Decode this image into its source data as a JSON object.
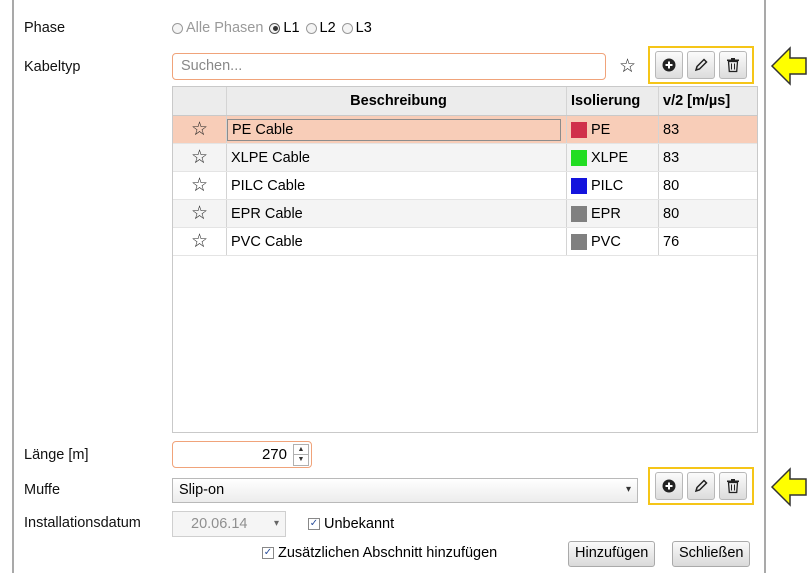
{
  "labels": {
    "phase": "Phase",
    "kabeltyp": "Kabeltyp",
    "laenge": "Länge [m]",
    "muffe": "Muffe",
    "installationsdatum": "Installationsdatum"
  },
  "phase_options": [
    {
      "label": "Alle Phasen",
      "state": "disabled"
    },
    {
      "label": "L1",
      "state": "checked"
    },
    {
      "label": "L2",
      "state": "unchecked"
    },
    {
      "label": "L3",
      "state": "unchecked"
    }
  ],
  "search": {
    "placeholder": "Suchen..."
  },
  "table": {
    "headers": {
      "description": "Beschreibung",
      "insulation": "Isolierung",
      "velocity": "v/2 [m/µs]"
    },
    "rows": [
      {
        "description": "PE Cable",
        "insulation": "PE",
        "color": "#d0304a",
        "velocity": "83"
      },
      {
        "description": "XLPE Cable",
        "insulation": "XLPE",
        "color": "#22dd22",
        "velocity": "83"
      },
      {
        "description": "PILC Cable",
        "insulation": "PILC",
        "color": "#1414dd",
        "velocity": "80"
      },
      {
        "description": "EPR Cable",
        "insulation": "EPR",
        "color": "#808080",
        "velocity": "80"
      },
      {
        "description": "PVC Cable",
        "insulation": "PVC",
        "color": "#808080",
        "velocity": "76"
      }
    ]
  },
  "length": {
    "value": "270"
  },
  "muffe": {
    "value": "Slip-on"
  },
  "date": {
    "value": "20.06.14"
  },
  "unbekannt": {
    "label": "Unbekannt",
    "checked": true
  },
  "add_section": {
    "label": "Zusätzlichen Abschnitt hinzufügen",
    "checked": true
  },
  "buttons": {
    "add": "Hinzufügen",
    "close": "Schließen"
  },
  "accents": {
    "highlight_box": "#f5c518",
    "arrow_fill": "#ffff00",
    "selected_row": "#f8cdb8"
  }
}
